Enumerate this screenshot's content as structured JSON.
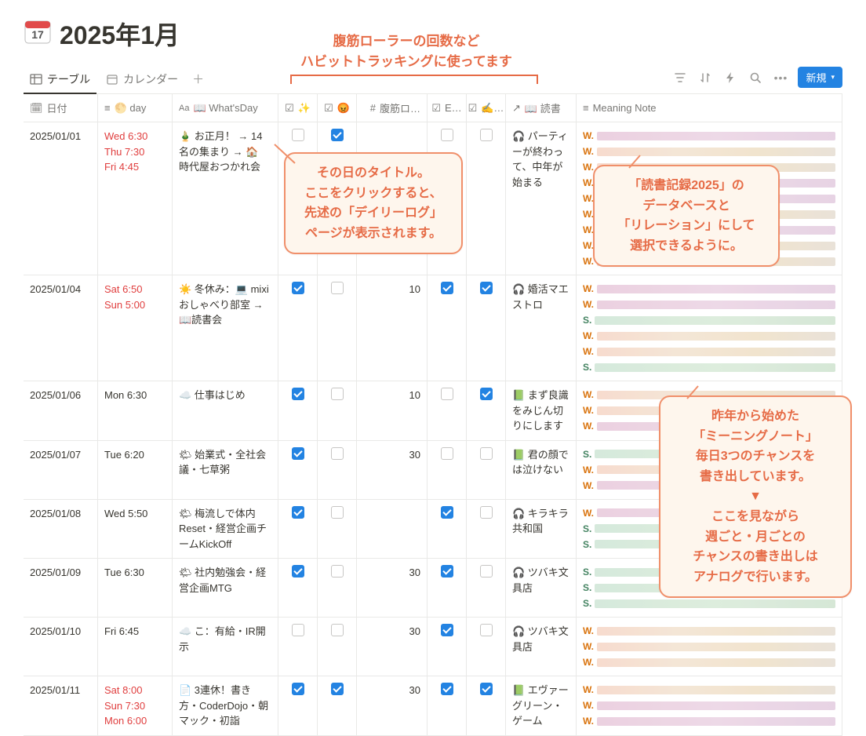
{
  "page": {
    "icon": "📅",
    "title": "2025年1月"
  },
  "tabs": {
    "table_label": "テーブル",
    "calendar_label": "カレンダー"
  },
  "toolbar": {
    "new_label": "新規"
  },
  "columns": {
    "date": "日付",
    "day": "🌕 day",
    "whats": "📖 What'sDay",
    "sparkle": "✨",
    "face": "😡",
    "abs": "腹筋ロ…",
    "e": "E…",
    "pen": "✍️…",
    "reading": "📖 読書",
    "meaning": "Meaning Note"
  },
  "annotations": {
    "habit_line1": "腹筋ローラーの回数など",
    "habit_line2": "ハビットトラッキングに使ってます",
    "title_callout_l1": "その日のタイトル。",
    "title_callout_l2": "ここをクリックすると、",
    "title_callout_l3": "先述の「デイリーログ」",
    "title_callout_l4": "ページが表示されます。",
    "reading_callout_l1": "「読書記録2025」の",
    "reading_callout_l2": "データベースと",
    "reading_callout_l3": "「リレーション」にして",
    "reading_callout_l4": "選択できるように。",
    "meaning_callout_l1": "昨年から始めた",
    "meaning_callout_l2": "「ミーニングノート」",
    "meaning_callout_l3": "毎日3つのチャンスを",
    "meaning_callout_l4": "書き出しています。",
    "meaning_callout_l5": "▼",
    "meaning_callout_l6": "ここを見ながら",
    "meaning_callout_l7": "週ごと・月ごとの",
    "meaning_callout_l8": "チャンスの書き出しは",
    "meaning_callout_l9": "アナログで行います。"
  },
  "rows": [
    {
      "date": "2025/01/01",
      "days": [
        {
          "t": "Wed 6:30",
          "we": false
        },
        {
          "t": "Thu 7:30",
          "we": false
        },
        {
          "t": "Fri 4:45",
          "we": false
        }
      ],
      "days_weekend_color": true,
      "whats": "🎍 お正月！ → 14名の集まり → 🏠 時代屋おつかれ会",
      "chk1": false,
      "chk2": true,
      "num": "",
      "chk3": false,
      "chk4": false,
      "reading": "🎧 パーティーが終わって、中年が始まる",
      "meaning": [
        {
          "p": "W"
        },
        {
          "p": "W"
        },
        {
          "p": "W"
        },
        {
          "p": "W"
        },
        {
          "p": "W"
        },
        {
          "p": "W"
        },
        {
          "p": "W"
        },
        {
          "p": "W"
        },
        {
          "p": "W"
        }
      ]
    },
    {
      "date": "2025/01/04",
      "days": [
        {
          "t": "Sat 6:50",
          "we": true
        },
        {
          "t": "Sun 5:00",
          "we": true
        }
      ],
      "whats": "☀️ 冬休み：💻 mixiおしゃべり部室 → 📖読書会",
      "chk1": true,
      "chk2": false,
      "num": "10",
      "chk3": true,
      "chk4": true,
      "reading": "🎧 婚活マエストロ",
      "meaning": [
        {
          "p": "W"
        },
        {
          "p": "W"
        },
        {
          "p": "S"
        },
        {
          "p": "W"
        },
        {
          "p": "W"
        },
        {
          "p": "S"
        }
      ]
    },
    {
      "date": "2025/01/06",
      "days": [
        {
          "t": "Mon 6:30",
          "we": false
        }
      ],
      "whats": "☁️ 仕事はじめ",
      "chk1": true,
      "chk2": false,
      "num": "10",
      "chk3": false,
      "chk4": true,
      "reading": "📗 まず良識をみじん切りにします",
      "meaning": [
        {
          "p": "W"
        },
        {
          "p": "W"
        },
        {
          "p": "W"
        }
      ]
    },
    {
      "date": "2025/01/07",
      "days": [
        {
          "t": "Tue 6:20",
          "we": false
        }
      ],
      "whats": "🌤 始業式・全社会議・七草粥",
      "chk1": true,
      "chk2": false,
      "num": "30",
      "chk3": false,
      "chk4": false,
      "reading": "📗 君の顔では泣けない",
      "meaning": [
        {
          "p": "S"
        },
        {
          "p": "W"
        },
        {
          "p": "W"
        }
      ]
    },
    {
      "date": "2025/01/08",
      "days": [
        {
          "t": "Wed 5:50",
          "we": false
        }
      ],
      "whats": "🌤 梅流しで体内Reset・経営企画チームKickOff",
      "chk1": true,
      "chk2": false,
      "num": "",
      "chk3": true,
      "chk4": false,
      "reading": "🎧 キラキラ共和国",
      "meaning": [
        {
          "p": "W"
        },
        {
          "p": "S"
        },
        {
          "p": "S"
        }
      ]
    },
    {
      "date": "2025/01/09",
      "days": [
        {
          "t": "Tue 6:30",
          "we": false
        }
      ],
      "whats": "🌤 社内勉強会・経営企画MTG",
      "chk1": true,
      "chk2": false,
      "num": "30",
      "chk3": true,
      "chk4": false,
      "reading": "🎧 ツバキ文具店",
      "meaning": [
        {
          "p": "S"
        },
        {
          "p": "S"
        },
        {
          "p": "S"
        }
      ]
    },
    {
      "date": "2025/01/10",
      "days": [
        {
          "t": "Fri 6:45",
          "we": false
        }
      ],
      "whats": "☁️ こ：有給・IR開示",
      "chk1": false,
      "chk2": false,
      "num": "30",
      "chk3": true,
      "chk4": false,
      "reading": "🎧 ツバキ文具店",
      "meaning": [
        {
          "p": "W"
        },
        {
          "p": "W"
        },
        {
          "p": "W"
        }
      ]
    },
    {
      "date": "2025/01/11",
      "days": [
        {
          "t": "Sat 8:00",
          "we": true
        },
        {
          "t": "Sun 7:30",
          "we": true
        },
        {
          "t": "Mon 6:00",
          "we": true
        }
      ],
      "whats": "📄 3連休！書き方・CoderDojo・朝マック・初詣",
      "chk1": true,
      "chk2": true,
      "num": "30",
      "chk3": true,
      "chk4": true,
      "reading": "📗 エヴァーグリーン・ゲーム",
      "meaning": [
        {
          "p": "W"
        },
        {
          "p": "W"
        },
        {
          "p": "W"
        }
      ]
    }
  ]
}
